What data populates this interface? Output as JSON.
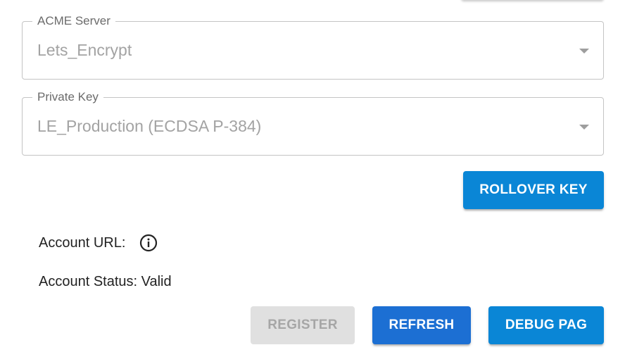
{
  "acme_server": {
    "label": "ACME Server",
    "value": "Lets_Encrypt"
  },
  "private_key": {
    "label": "Private Key",
    "value": "LE_Production (ECDSA P-384)"
  },
  "buttons": {
    "rollover_key": "ROLLOVER KEY",
    "register": "REGISTER",
    "refresh": "REFRESH",
    "debug_page": "DEBUG PAG"
  },
  "account": {
    "url_label": "Account URL:",
    "status_text": "Account Status: Valid"
  },
  "icons": {
    "info": "info-icon",
    "dropdown": "chevron-down-icon"
  },
  "colors": {
    "primary": "#0a86d6",
    "refresh": "#1c6fd3",
    "disabled": "#e0e0e0"
  }
}
